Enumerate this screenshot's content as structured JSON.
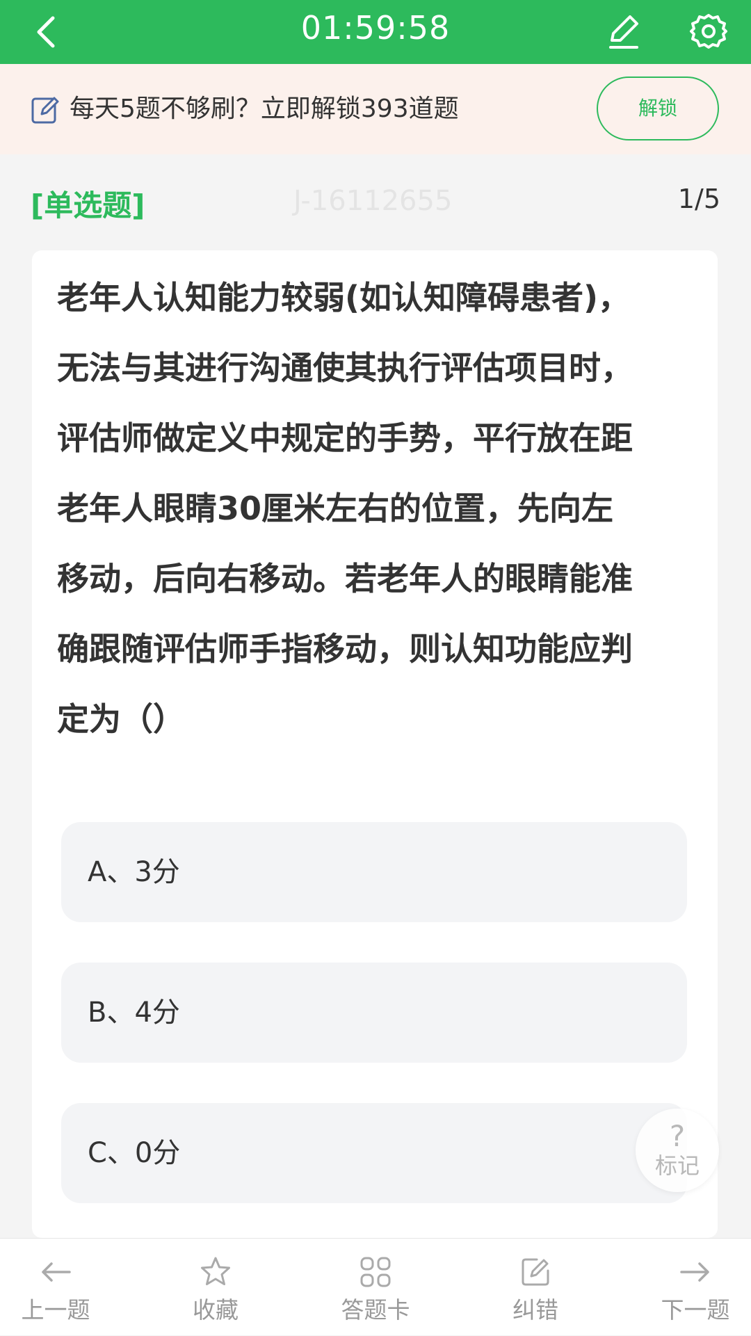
{
  "header": {
    "timer": "01:59:58"
  },
  "banner": {
    "text": "每天5题不够刷？立即解锁393道题",
    "unlock_label": "解锁"
  },
  "question": {
    "type_label": "[单选题]",
    "id_watermark": "J-16112655",
    "progress": "1/5",
    "stem_lines": [
      "老年人认知能力较弱(如认知障碍患者)，",
      "无法与其进行沟通使其执行评估项目时，",
      "评估师做定义中规定的手势，平行放在距",
      "老年人眼睛30厘米左右的位置，先向左",
      "移动，后向右移动。若老年人的眼睛能准",
      "确跟随评估师手指移动，则认知功能应判",
      "定为（）"
    ],
    "options": [
      "A、3分",
      "B、4分",
      "C、0分"
    ]
  },
  "mark_button": {
    "glyph": "?",
    "label": "标记"
  },
  "bottom_nav": {
    "prev": "上一题",
    "favorite": "收藏",
    "answer_card": "答题卡",
    "report_error": "纠错",
    "next": "下一题"
  },
  "colors": {
    "accent": "#2dba5c",
    "banner_bg": "#fcf1ec",
    "option_bg": "#f3f4f6"
  },
  "icons": [
    "back-arrow-icon",
    "pencil-icon",
    "gear-icon",
    "edit-note-icon",
    "left-arrow-icon",
    "star-icon",
    "grid-icon",
    "edit-icon",
    "right-arrow-icon"
  ]
}
